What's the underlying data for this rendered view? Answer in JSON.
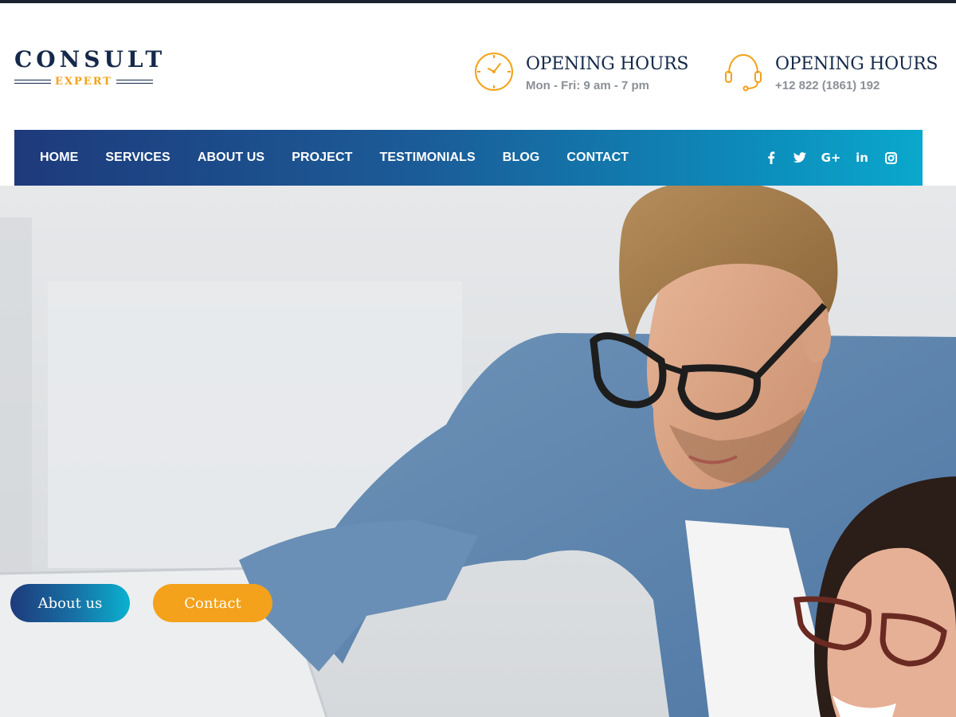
{
  "logo": {
    "main": "CONSULT",
    "sub": "EXPERT"
  },
  "header_info": [
    {
      "icon": "clock-icon",
      "title": "OPENING HOURS",
      "subtitle": "Mon - Fri: 9 am - 7 pm"
    },
    {
      "icon": "headset-icon",
      "title": "OPENING HOURS",
      "subtitle": "+12 822 (1861) 192"
    }
  ],
  "nav": {
    "items": [
      "HOME",
      "SERVICES",
      "ABOUT US",
      "PROJECT",
      "TESTIMONIALS",
      "BLOG",
      "CONTACT"
    ]
  },
  "social": [
    "facebook-icon",
    "twitter-icon",
    "google-plus-icon",
    "linkedin-icon",
    "instagram-icon"
  ],
  "social_glyphs": {
    "google_plus": "G+",
    "linkedin": "in"
  },
  "hero": {
    "buttons": {
      "about": "About us",
      "contact": "Contact"
    }
  },
  "colors": {
    "brand_navy": "#14294a",
    "accent_orange": "#f3a11a",
    "nav_gradient_start": "#1e3a7b",
    "nav_gradient_end": "#0aa8cc",
    "muted_text": "#8b8f96"
  }
}
